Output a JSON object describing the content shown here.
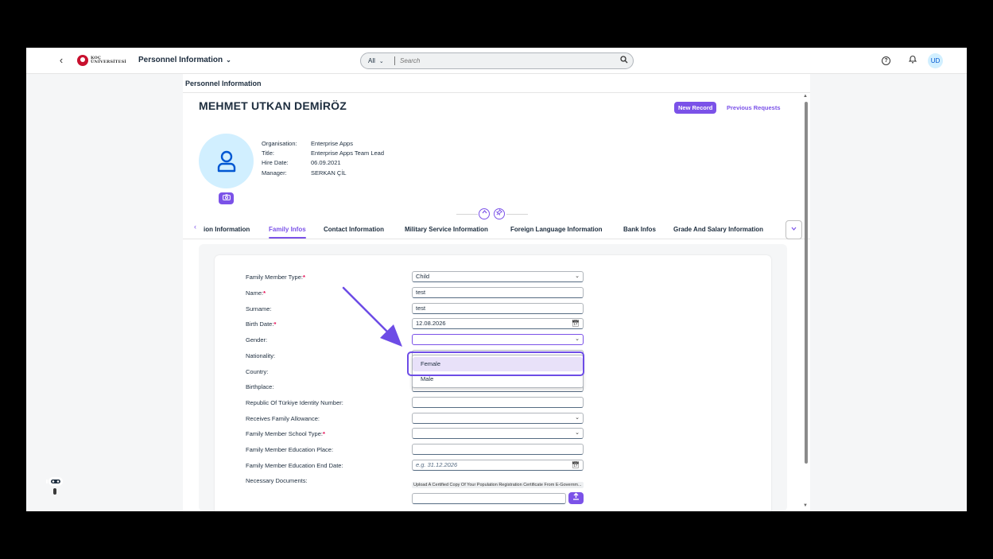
{
  "shell": {
    "logo_text_line1": "KOÇ",
    "logo_text_line2": "ÜNİVERSİTESİ",
    "app_title": "Personnel Information",
    "search_scope": "All",
    "search_placeholder": "Search",
    "avatar_initials": "UD"
  },
  "page": {
    "title": "Personnel Information",
    "employee_name": "MEHMET UTKAN DEMİRÖZ",
    "new_record_label": "New Record",
    "previous_requests_label": "Previous Requests",
    "info": [
      {
        "label": "Organisation:",
        "value": "Enterprise Apps"
      },
      {
        "label": "Title:",
        "value": "Enterprise Apps Team Lead"
      },
      {
        "label": "Hire Date:",
        "value": "06.09.2021"
      },
      {
        "label": "Manager:",
        "value": "SERKAN ÇİL"
      }
    ]
  },
  "tabs": [
    {
      "label": "ion Information",
      "active": false
    },
    {
      "label": "Family Infos",
      "active": true
    },
    {
      "label": "Contact Information",
      "active": false
    },
    {
      "label": "Military Service Information",
      "active": false
    },
    {
      "label": "Foreign Language Information",
      "active": false
    },
    {
      "label": "Bank Infos",
      "active": false
    },
    {
      "label": "Grade And Salary Information",
      "active": false
    }
  ],
  "form": {
    "fields": [
      {
        "label": "Family Member Type:",
        "required": true,
        "value": "Child",
        "type": "select"
      },
      {
        "label": "Name:",
        "required": true,
        "value": "test",
        "type": "text"
      },
      {
        "label": "Surname:",
        "required": false,
        "value": "test",
        "type": "text"
      },
      {
        "label": "Birth Date:",
        "required": true,
        "value": "12.08.2026",
        "type": "date"
      },
      {
        "label": "Gender:",
        "required": false,
        "value": "",
        "type": "select"
      },
      {
        "label": "Nationality:",
        "required": false,
        "value": "",
        "type": "select"
      },
      {
        "label": "Country:",
        "required": false,
        "value": "",
        "type": "select"
      },
      {
        "label": "Birthplace:",
        "required": false,
        "value": "",
        "type": "text"
      },
      {
        "label": "Republic Of Türkiye Identity Number:",
        "required": false,
        "value": "",
        "type": "text"
      },
      {
        "label": "Receives Family Allowance:",
        "required": false,
        "value": "",
        "type": "select"
      },
      {
        "label": "Family Member School Type:",
        "required": true,
        "value": "",
        "type": "select"
      },
      {
        "label": "Family Member Education Place:",
        "required": false,
        "value": "",
        "type": "text"
      },
      {
        "label": "Family Member Education End Date:",
        "required": false,
        "value": "",
        "placeholder": "e.g. 31.12.2026",
        "type": "date"
      }
    ],
    "necessary_documents_label": "Necessary Documents:",
    "upload_note": "Upload A Certified Copy Of Your Population Registration Certificate From E-Governm...",
    "gender_options": [
      "Female",
      "Male"
    ],
    "highlighted_option": "Female"
  },
  "colors": {
    "accent": "#7b52e8",
    "annotation": "#6d4ce6"
  }
}
